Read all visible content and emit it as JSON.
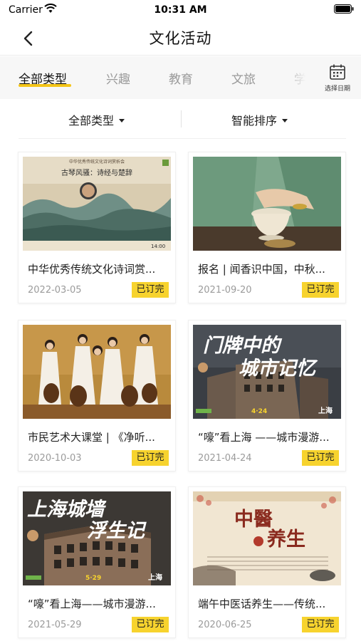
{
  "status_bar": {
    "carrier": "Carrier",
    "time": "10:31 AM"
  },
  "nav": {
    "title": "文化活动",
    "back_icon": "chevron-left-icon"
  },
  "tabs": [
    {
      "label": "全部类型",
      "active": true
    },
    {
      "label": "兴趣",
      "active": false
    },
    {
      "label": "教育",
      "active": false
    },
    {
      "label": "文旅",
      "active": false
    },
    {
      "label": "学习",
      "active": false
    }
  ],
  "date_picker": {
    "label": "选择日期",
    "icon": "calendar-icon"
  },
  "filters": {
    "type_label": "全部类型",
    "sort_label": "智能排序"
  },
  "cards": [
    {
      "title": "中华优秀传统文化诗词赏...",
      "date": "2022-03-05",
      "status": "已订完",
      "image_text": {
        "line1": "中华优秀传统文化诗词赏析会",
        "line2": "古琴风骚：诗经与楚辞",
        "time": "14:00"
      }
    },
    {
      "title": "报名 | 闻香识中国，中秋...",
      "date": "2021-09-20",
      "status": "已订完"
    },
    {
      "title": "市民艺术大课堂 | 《净听...",
      "date": "2020-10-03",
      "status": "已订完"
    },
    {
      "title": "“嚎”看上海 ——城市漫游...",
      "date": "2021-04-24",
      "status": "已订完",
      "image_text": {
        "line1": "门牌中的",
        "line2": "城市记忆",
        "date": "4·24",
        "city": "上海"
      }
    },
    {
      "title": "“嚎”看上海——城市漫游...",
      "date": "2021-05-29",
      "status": "已订完",
      "image_text": {
        "line1": "上海城墙",
        "line2": "浮生记",
        "date": "5·29",
        "city": "上海"
      }
    },
    {
      "title": "端午中医话养生——传统...",
      "date": "2020-06-25",
      "status": "已订完",
      "image_text": {
        "line1": "中醫",
        "line2": "养生"
      }
    }
  ],
  "colors": {
    "accent_yellow": "#f7d32e",
    "underline": "#f5c518",
    "tab_background": "#f7f7f7",
    "inactive_tab": "#9a9a9a"
  }
}
